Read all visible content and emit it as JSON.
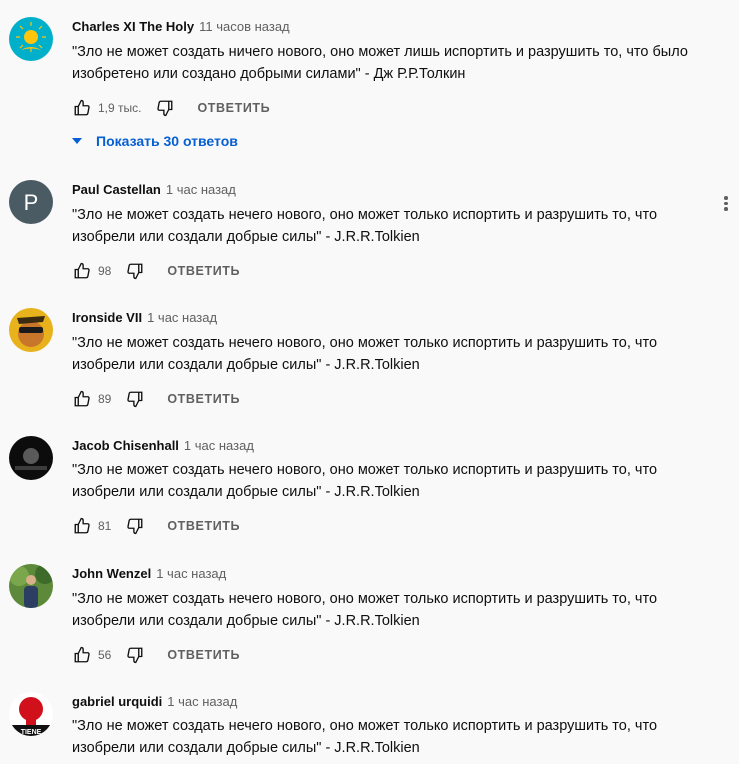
{
  "comments": [
    {
      "author": "Charles XI The Holy",
      "time": "11 часов назад",
      "text": "\"Зло не может создать ничего нового, оно может лишь испортить и разрушить то, что было изобретено или создано добрыми силами\" - Дж Р.Р.Толкин",
      "likes": "1,9 тыс.",
      "reply_label": "ОТВЕТИТЬ",
      "avatar": "kazakhstan-flag-avatar"
    },
    {
      "author": "Paul Castellan",
      "time": "1 час назад",
      "text": "\"Зло не может создать нечего нового, оно может только испортить и разрушить то, что изобрели или создали добрые силы\" - J.R.R.Tolkien",
      "likes": "98",
      "reply_label": "ОТВЕТИТЬ",
      "avatar": "letter-avatar",
      "avatar_letter": "P"
    },
    {
      "author": "Ironside VII",
      "time": "1 час назад",
      "text": "\"Зло не может создать нечего нового, оно может только испортить и разрушить то, что изобрели или создали добрые силы\" - J.R.R.Tolkien",
      "likes": "89",
      "reply_label": "ОТВЕТИТЬ",
      "avatar": "photo-avatar"
    },
    {
      "author": "Jacob Chisenhall",
      "time": "1 час назад",
      "text": "\"Зло не может создать нечего нового, оно может только испортить и разрушить то, что изобрели или создали добрые силы\" - J.R.R.Tolkien",
      "likes": "81",
      "reply_label": "ОТВЕТИТЬ",
      "avatar": "photo-avatar"
    },
    {
      "author": "John Wenzel",
      "time": "1 час назад",
      "text": "\"Зло не может создать нечего нового, оно может только испортить и разрушить то, что изобрели или создали добрые силы\" - J.R.R.Tolkien",
      "likes": "56",
      "reply_label": "ОТВЕТИТЬ",
      "avatar": "photo-avatar"
    },
    {
      "author": "gabriel urquidi",
      "time": "1 час назад",
      "text": "\"Зло не может создать нечего нового, оно может только испортить и разрушить то, что изобрели или создали добрые силы\" - J.R.R.Tolkien",
      "avatar": "photo-avatar",
      "avatar_text": "TIENE"
    }
  ],
  "replies_toggle": {
    "label": "Показать 30 ответов"
  },
  "colors": {
    "link": "#065fd4",
    "secondary_text": "#606060",
    "primary_text": "#0f0f0f",
    "background": "#f9f9f9"
  }
}
